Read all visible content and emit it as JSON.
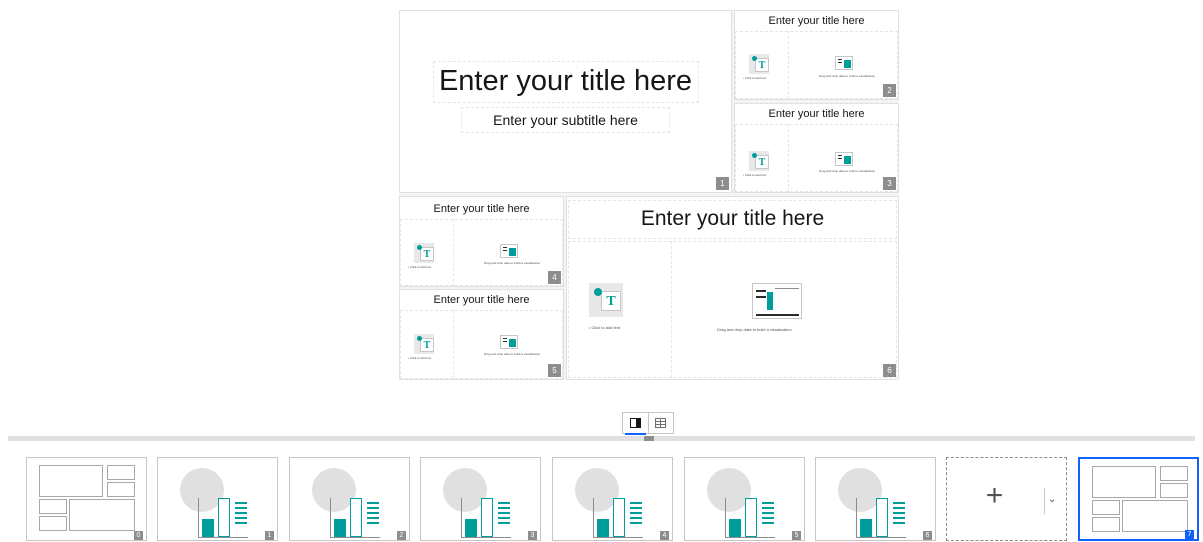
{
  "panels": [
    {
      "num": "1",
      "title": "Enter your title here",
      "subtitle": "Enter your subtitle here"
    },
    {
      "num": "2",
      "title": "Enter your title here",
      "text_caption": "• Click to add text",
      "viz_caption": "Drag and drop data to build a visualization"
    },
    {
      "num": "3",
      "title": "Enter your title here",
      "text_caption": "• Click to add text",
      "viz_caption": "Drag and drop data to build a visualization"
    },
    {
      "num": "4",
      "title": "Enter your title here",
      "text_caption": "• Click to add text",
      "viz_caption": "Drag and drop data to build a visualization"
    },
    {
      "num": "5",
      "title": "Enter your title here",
      "text_caption": "• Click to add text",
      "viz_caption": "Drag and drop data to build a visualization"
    },
    {
      "num": "6",
      "title": "Enter your title here",
      "text_caption": "• Click to add text",
      "viz_caption": "Drag and drop data to build a visualization"
    }
  ],
  "text_icon_letter": "T",
  "view_toggle": {
    "selected": "single-view",
    "options": [
      "single-view-icon",
      "grid-view-icon"
    ]
  },
  "strip": {
    "thumbs": [
      {
        "num": "0",
        "kind": "layout"
      },
      {
        "num": "1",
        "kind": "chart"
      },
      {
        "num": "2",
        "kind": "chart"
      },
      {
        "num": "3",
        "kind": "chart"
      },
      {
        "num": "4",
        "kind": "chart"
      },
      {
        "num": "5",
        "kind": "chart"
      },
      {
        "num": "6",
        "kind": "chart"
      },
      {
        "num": "7",
        "kind": "layout",
        "selected": true
      }
    ],
    "add_symbol": "+",
    "dropdown_symbol": "⌄"
  },
  "colors": {
    "accent": "#0f62fe",
    "teal": "#009d9a",
    "badge": "#8d8d8d"
  }
}
